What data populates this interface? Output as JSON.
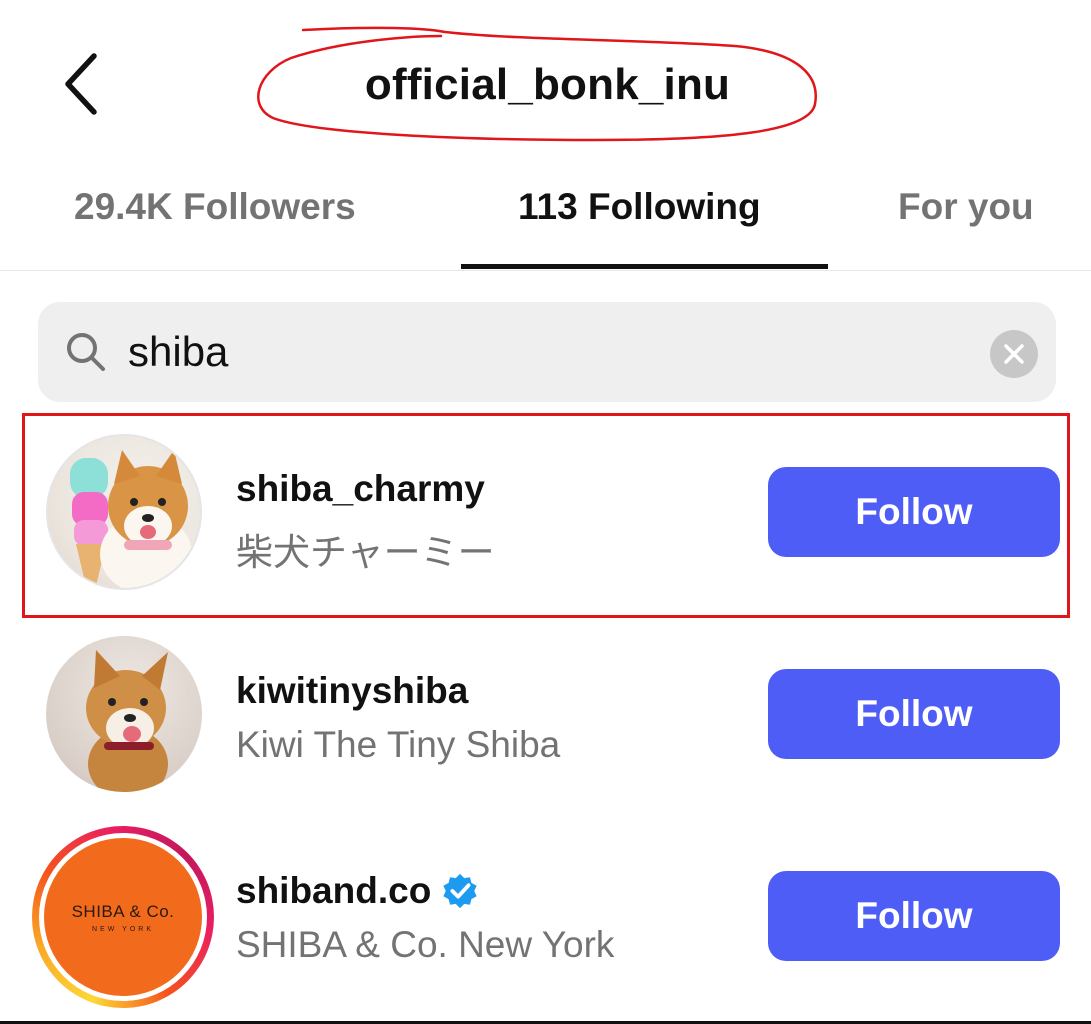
{
  "header": {
    "title": "official_bonk_inu"
  },
  "tabs": [
    {
      "label": "29.4K Followers",
      "active": false
    },
    {
      "label": "113 Following",
      "active": true
    },
    {
      "label": "For you",
      "active": false
    }
  ],
  "search": {
    "value": "shiba",
    "icon": "search-icon",
    "clear_icon": "close-icon"
  },
  "accounts": [
    {
      "username": "shiba_charmy",
      "full_name": "柴犬チャーミー",
      "verified": false,
      "action": "Follow",
      "highlighted": true
    },
    {
      "username": "kiwitinyshiba",
      "full_name": "Kiwi The Tiny Shiba",
      "verified": false,
      "action": "Follow",
      "highlighted": false
    },
    {
      "username": "shiband.co",
      "full_name": "SHIBA & Co. New York",
      "verified": true,
      "action": "Follow",
      "highlighted": false,
      "avatar_text": "SHIBA & Co.",
      "avatar_subtext": "NEW YORK"
    }
  ],
  "colors": {
    "follow_button": "#4d5df5",
    "verified_badge": "#1d9bf0",
    "annotation": "#e0161b"
  }
}
